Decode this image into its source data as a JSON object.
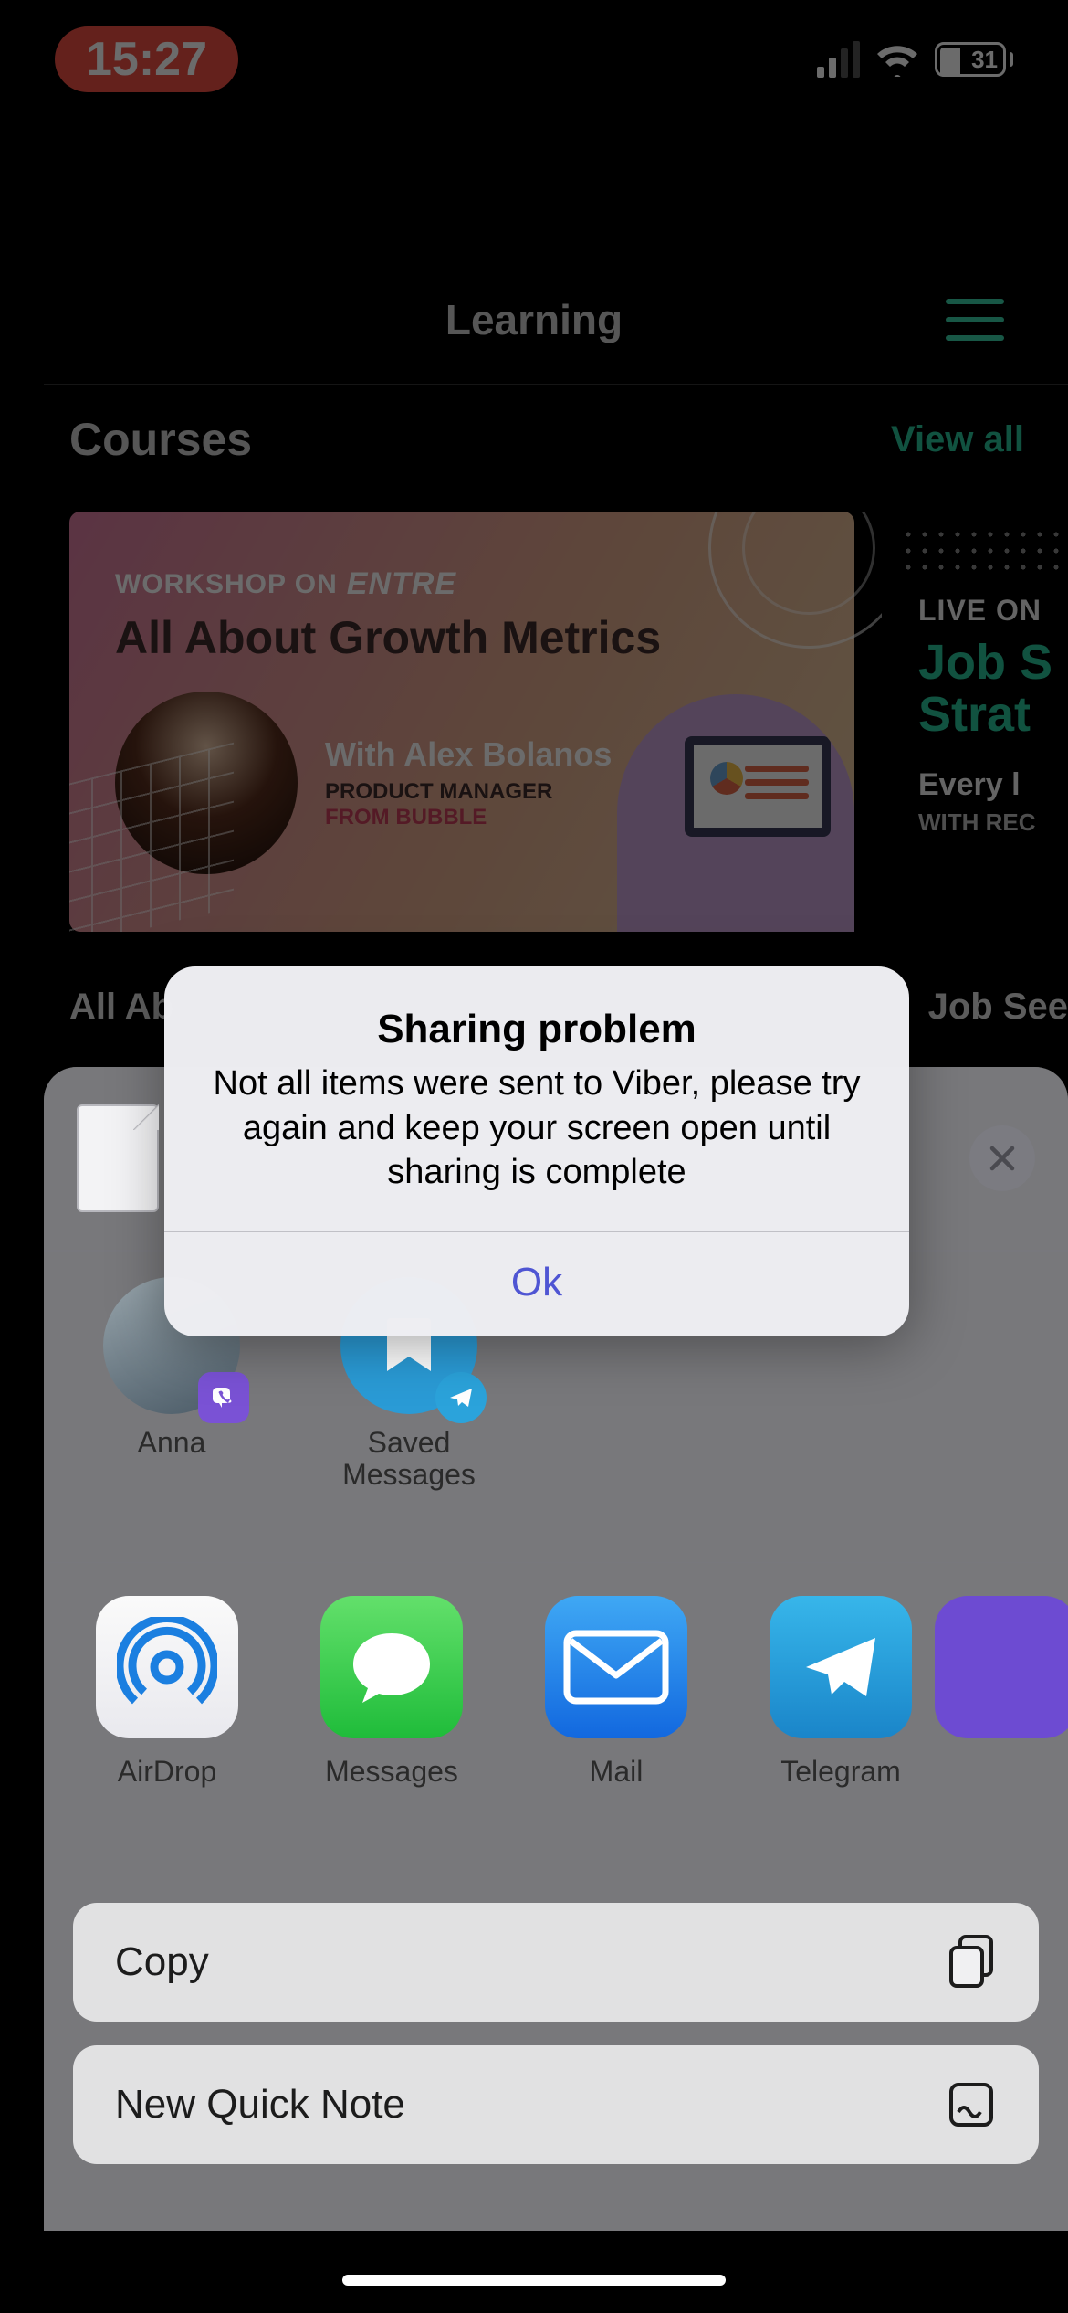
{
  "status": {
    "time": "15:27",
    "battery": "31"
  },
  "header": {
    "title": "Learning"
  },
  "section": {
    "title": "Courses",
    "view_all": "View all"
  },
  "course1": {
    "tag_pre": "WORKSHOP ON",
    "tag_brand": "ENTRE",
    "title": "All About Growth Metrics",
    "with": "With Alex Bolanos",
    "role": "PRODUCT MANAGER",
    "from": "FROM BUBBLE"
  },
  "course2": {
    "live": "LIVE ON",
    "title": "Job S\nStrat",
    "every": "Every l",
    "with": "WITH REC"
  },
  "tags": {
    "left": "All Ab",
    "right": "Job See"
  },
  "share": {
    "contacts": [
      {
        "name": "Anna"
      },
      {
        "name": "Saved Messages"
      }
    ],
    "apps": {
      "airdrop": "AirDrop",
      "messages": "Messages",
      "mail": "Mail",
      "telegram": "Telegram"
    },
    "actions": {
      "copy": "Copy",
      "quicknote": "New Quick Note"
    }
  },
  "alert": {
    "title": "Sharing problem",
    "message": "Not all items were sent to Viber, please try again and keep your screen open until sharing is complete",
    "ok": "Ok"
  }
}
